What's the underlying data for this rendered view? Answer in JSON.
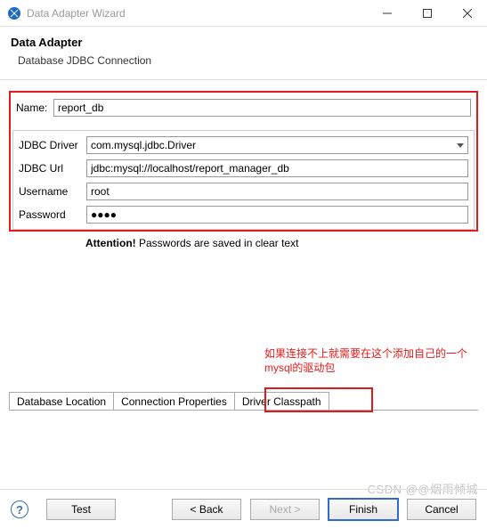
{
  "window": {
    "title": "Data Adapter Wizard"
  },
  "header": {
    "title": "Data Adapter",
    "subtitle": "Database JDBC Connection"
  },
  "form": {
    "name_label": "Name:",
    "name_value": "report_db",
    "jdbc_driver_label": "JDBC Driver",
    "jdbc_driver_value": "com.mysql.jdbc.Driver",
    "jdbc_url_label": "JDBC Url",
    "jdbc_url_value": "jdbc:mysql://localhost/report_manager_db",
    "username_label": "Username",
    "username_value": "root",
    "password_label": "Password",
    "password_value": "●●●●",
    "attention_bold": "Attention!",
    "attention_text": " Passwords are saved in clear text"
  },
  "tabs": {
    "items": [
      {
        "label": "Database Location"
      },
      {
        "label": "Connection Properties"
      },
      {
        "label": "Driver Classpath"
      }
    ]
  },
  "annotation": {
    "text": "如果连接不上就需要在这个添加自己的一个mysql的驱动包"
  },
  "footer": {
    "test": "Test",
    "back": "< Back",
    "next": "Next >",
    "finish": "Finish",
    "cancel": "Cancel"
  },
  "watermark": {
    "text": "CSDN @@烟雨倾城"
  }
}
